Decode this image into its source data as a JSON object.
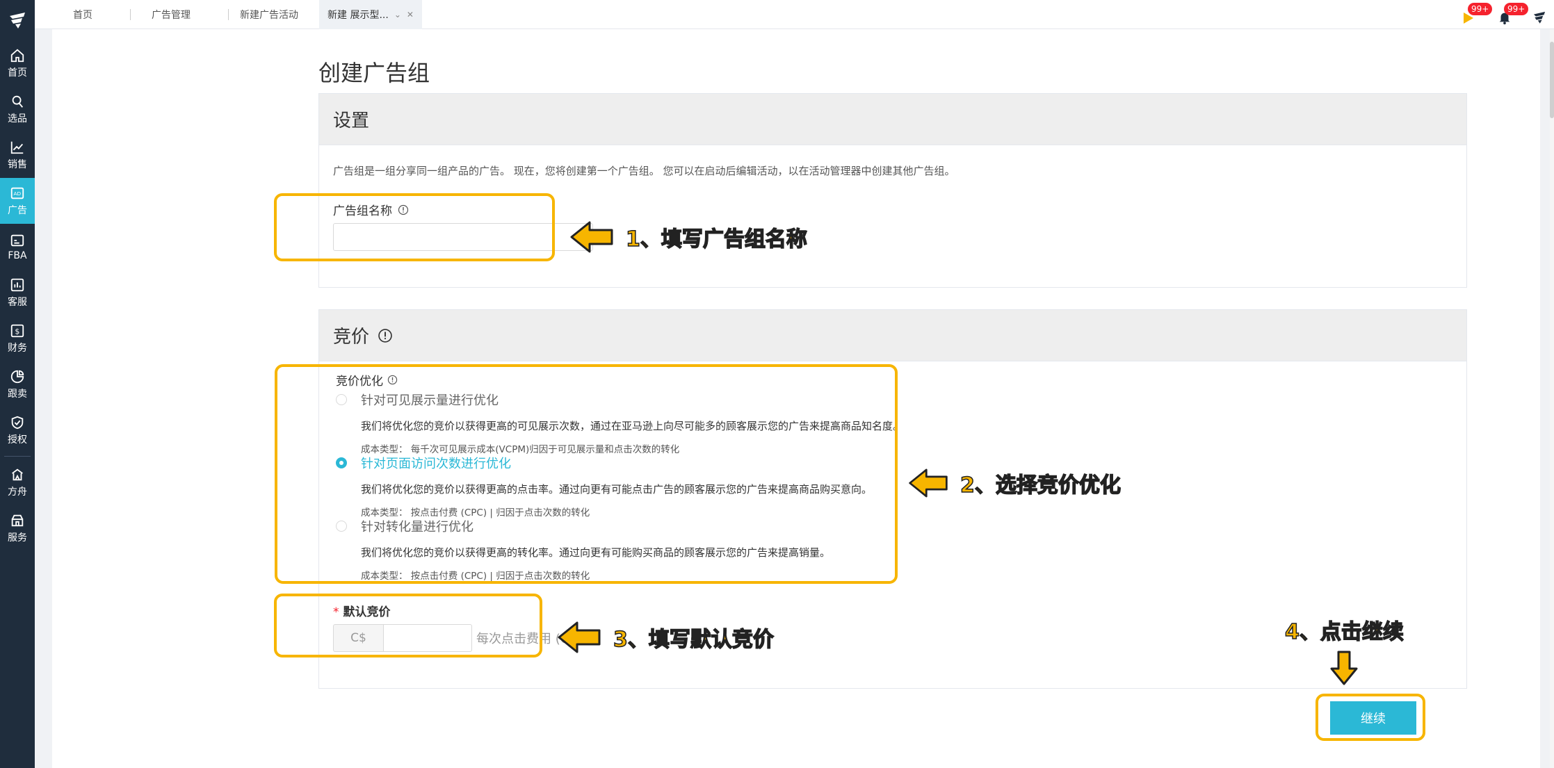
{
  "colors": {
    "accent": "#2bb8d6",
    "annotation": "#f7b500",
    "sidebar": "#1f2d3d",
    "badge": "#f5222d"
  },
  "sidebar": {
    "items": [
      {
        "label": "首页",
        "icon": "home-icon"
      },
      {
        "label": "选品",
        "icon": "search-icon"
      },
      {
        "label": "销售",
        "icon": "trend-icon"
      },
      {
        "label": "广告",
        "icon": "ad-icon",
        "active": true
      },
      {
        "label": "FBA",
        "icon": "box-icon"
      },
      {
        "label": "客服",
        "icon": "chart-box-icon"
      },
      {
        "label": "财务",
        "icon": "dollar-icon"
      },
      {
        "label": "跟卖",
        "icon": "pie-icon"
      },
      {
        "label": "授权",
        "icon": "shield-icon"
      },
      {
        "label": "方舟",
        "icon": "ark-icon"
      },
      {
        "label": "服务",
        "icon": "shop-icon"
      }
    ]
  },
  "tabs": [
    {
      "label": "首页"
    },
    {
      "label": "广告管理"
    },
    {
      "label": "新建广告活动"
    },
    {
      "label": "新建 展示型...",
      "active": true
    }
  ],
  "header": {
    "notif_badge_1": "99+",
    "notif_badge_2": "99+"
  },
  "page": {
    "title": "创建广告组"
  },
  "settings": {
    "title": "设置",
    "description": "广告组是一组分享同一组产品的广告。 现在，您将创建第一个广告组。 您可以在启动后编辑活动，以在活动管理器中创建其他广告组。",
    "group_name_label": "广告组名称",
    "group_name_value": ""
  },
  "bidding": {
    "title": "竞价",
    "optimization_label": "竞价优化",
    "options": [
      {
        "title": "针对可见展示量进行优化",
        "description": "我们将优化您的竞价以获得更高的可见展示次数，通过在亚马逊上向尽可能多的顾客展示您的广告来提高商品知名度。",
        "cost": "成本类型： 每千次可见展示成本(VCPM)归因于可见展示量和点击次数的转化",
        "selected": false
      },
      {
        "title": "针对页面访问次数进行优化",
        "description": "我们将优化您的竞价以获得更高的点击率。通过向更有可能点击广告的顾客展示您的广告来提高商品购买意向。",
        "cost": "成本类型： 按点击付费 (CPC) | 归因于点击次数的转化",
        "selected": true
      },
      {
        "title": "针对转化量进行优化",
        "description": "我们将优化您的竞价以获得更高的转化率。通过向更有可能购买商品的顾客展示您的广告来提高销量。",
        "cost": "成本类型： 按点击付费 (CPC) | 归因于点击次数的转化",
        "selected": false
      }
    ],
    "default_bid_label": "默认竞价",
    "required_mark": "*",
    "currency": "C$",
    "default_bid_value": "",
    "bid_suffix": "每次点击费用 (CPC)"
  },
  "continue_label": "继续",
  "annotations": {
    "step1": "1、填写广告组名称",
    "step2": "2、选择竞价优化",
    "step3": "3、填写默认竞价",
    "step4": "4、点击继续"
  }
}
